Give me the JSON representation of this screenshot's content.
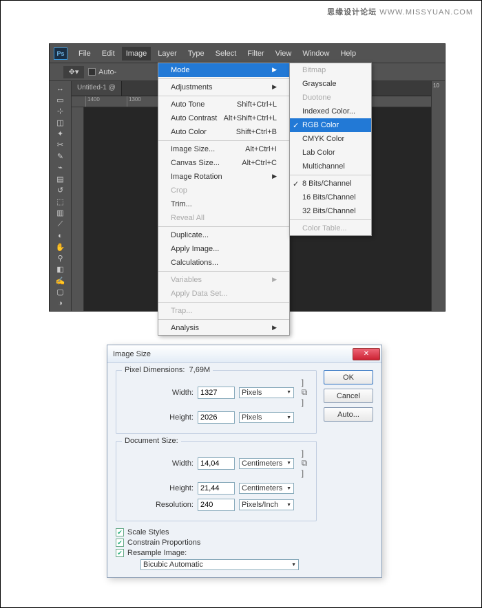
{
  "watermark": {
    "cn": "思缘设计论坛",
    "en": "WWW.MISSYUAN.COM"
  },
  "menubar": [
    "File",
    "Edit",
    "Image",
    "Layer",
    "Type",
    "Select",
    "Filter",
    "View",
    "Window",
    "Help"
  ],
  "options": {
    "auto_label": "Auto-"
  },
  "tab_title": "Untitled-1 @",
  "ruler": [
    "1400",
    "1300"
  ],
  "side_label": "10",
  "image_menu": {
    "mode": "Mode",
    "adjustments": "Adjustments",
    "auto_tone": "Auto Tone",
    "auto_tone_sc": "Shift+Ctrl+L",
    "auto_contrast": "Auto Contrast",
    "auto_contrast_sc": "Alt+Shift+Ctrl+L",
    "auto_color": "Auto Color",
    "auto_color_sc": "Shift+Ctrl+B",
    "image_size": "Image Size...",
    "image_size_sc": "Alt+Ctrl+I",
    "canvas_size": "Canvas Size...",
    "canvas_size_sc": "Alt+Ctrl+C",
    "image_rotation": "Image Rotation",
    "crop": "Crop",
    "trim": "Trim...",
    "reveal": "Reveal All",
    "duplicate": "Duplicate...",
    "apply": "Apply Image...",
    "calc": "Calculations...",
    "variables": "Variables",
    "apply_ds": "Apply Data Set...",
    "trap": "Trap...",
    "analysis": "Analysis"
  },
  "mode_menu": {
    "bitmap": "Bitmap",
    "grayscale": "Grayscale",
    "duotone": "Duotone",
    "indexed": "Indexed Color...",
    "rgb": "RGB Color",
    "cmyk": "CMYK Color",
    "lab": "Lab Color",
    "multi": "Multichannel",
    "b8": "8 Bits/Channel",
    "b16": "16 Bits/Channel",
    "b32": "32 Bits/Channel",
    "color_table": "Color Table..."
  },
  "dialog": {
    "title": "Image Size",
    "pixel_dims": "Pixel Dimensions:",
    "pixel_dims_val": "7,69M",
    "width_l": "Width:",
    "height_l": "Height:",
    "resolution_l": "Resolution:",
    "px_w": "1327",
    "px_h": "2026",
    "unit_px": "Pixels",
    "doc_size": "Document Size:",
    "doc_w": "14,04",
    "doc_h": "21,44",
    "unit_cm": "Centimeters",
    "res": "240",
    "unit_res": "Pixels/Inch",
    "scale": "Scale Styles",
    "constrain": "Constrain Proportions",
    "resample": "Resample Image:",
    "method": "Bicubic Automatic",
    "ok": "OK",
    "cancel": "Cancel",
    "auto": "Auto..."
  },
  "tool_icons": [
    "↔",
    "▭",
    "⊹",
    "◫",
    "✦",
    "✂",
    "✎",
    "⌁",
    "▤",
    "↺",
    "⬚",
    "▥",
    "⟋",
    "◐",
    "✋",
    "⚲",
    "◧",
    "✍",
    "▢",
    "◑"
  ]
}
